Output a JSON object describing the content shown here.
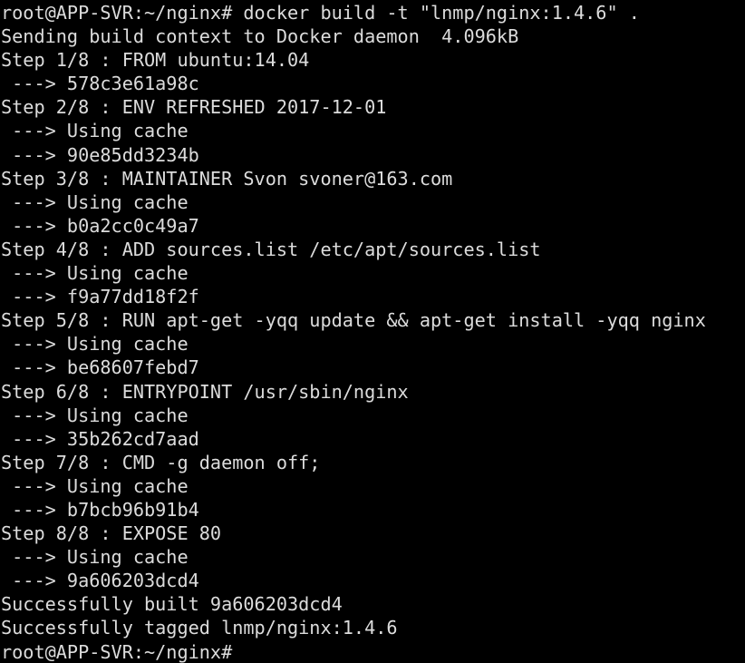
{
  "terminal": {
    "theme": {
      "background": "#000000",
      "foreground": "#dcdcdc"
    },
    "prompt": "root@APP-SVR:~/nginx#",
    "command": "docker build -t \"lnmp/nginx:1.4.6\" .",
    "lines": [
      "root@APP-SVR:~/nginx# docker build -t \"lnmp/nginx:1.4.6\" .",
      "Sending build context to Docker daemon  4.096kB",
      "Step 1/8 : FROM ubuntu:14.04",
      " ---> 578c3e61a98c",
      "Step 2/8 : ENV REFRESHED 2017-12-01",
      " ---> Using cache",
      " ---> 90e85dd3234b",
      "Step 3/8 : MAINTAINER Svon svoner@163.com",
      " ---> Using cache",
      " ---> b0a2cc0c49a7",
      "Step 4/8 : ADD sources.list /etc/apt/sources.list",
      " ---> Using cache",
      " ---> f9a77dd18f2f",
      "Step 5/8 : RUN apt-get -yqq update && apt-get install -yqq nginx",
      " ---> Using cache",
      " ---> be68607febd7",
      "Step 6/8 : ENTRYPOINT /usr/sbin/nginx",
      " ---> Using cache",
      " ---> 35b262cd7aad",
      "Step 7/8 : CMD -g daemon off;",
      " ---> Using cache",
      " ---> b7bcb96b91b4",
      "Step 8/8 : EXPOSE 80",
      " ---> Using cache",
      " ---> 9a606203dcd4",
      "Successfully built 9a606203dcd4",
      "Successfully tagged lnmp/nginx:1.4.6",
      "root@APP-SVR:~/nginx#"
    ],
    "build_context_size": "4.096kB",
    "total_steps": 8,
    "base_image": "ubuntu:14.04",
    "maintainer": "Svon svoner@163.com",
    "image_id": "9a606203dcd4",
    "image_tag": "lnmp/nginx:1.4.6",
    "steps": [
      {
        "index": "1/8",
        "instruction": "FROM ubuntu:14.04",
        "layer": "578c3e61a98c",
        "cached": false
      },
      {
        "index": "2/8",
        "instruction": "ENV REFRESHED 2017-12-01",
        "layer": "90e85dd3234b",
        "cached": true
      },
      {
        "index": "3/8",
        "instruction": "MAINTAINER Svon svoner@163.com",
        "layer": "b0a2cc0c49a7",
        "cached": true
      },
      {
        "index": "4/8",
        "instruction": "ADD sources.list /etc/apt/sources.list",
        "layer": "f9a77dd18f2f",
        "cached": true
      },
      {
        "index": "5/8",
        "instruction": "RUN apt-get -yqq update && apt-get install -yqq nginx",
        "layer": "be68607febd7",
        "cached": true
      },
      {
        "index": "6/8",
        "instruction": "ENTRYPOINT /usr/sbin/nginx",
        "layer": "35b262cd7aad",
        "cached": true
      },
      {
        "index": "7/8",
        "instruction": "CMD -g daemon off;",
        "layer": "b7bcb96b91b4",
        "cached": true
      },
      {
        "index": "8/8",
        "instruction": "EXPOSE 80",
        "layer": "9a606203dcd4",
        "cached": true
      }
    ]
  }
}
